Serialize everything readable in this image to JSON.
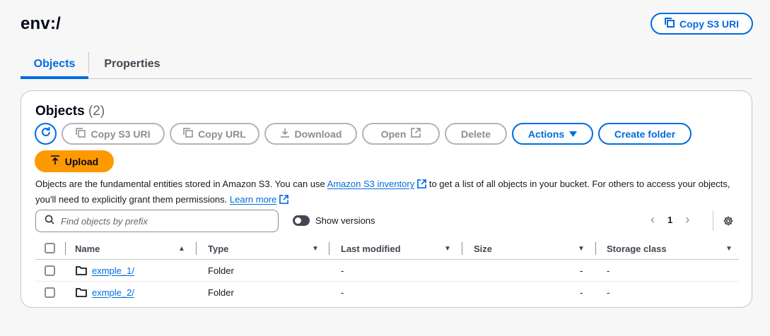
{
  "header": {
    "title": "env:/",
    "copy_s3_uri_label": "Copy S3 URI"
  },
  "tabs": [
    {
      "label": "Objects",
      "active": true
    },
    {
      "label": "Properties",
      "active": false
    }
  ],
  "panel": {
    "title": "Objects",
    "count": "(2)",
    "toolbar": {
      "copy_s3_uri": "Copy S3 URI",
      "copy_url": "Copy URL",
      "download": "Download",
      "open": "Open",
      "delete": "Delete",
      "actions": "Actions",
      "create_folder": "Create folder",
      "upload": "Upload"
    },
    "description": {
      "part1": "Objects are the fundamental entities stored in Amazon S3. You can use ",
      "inventory_link": "Amazon S3 inventory",
      "part2": " to get a list of all objects in your bucket. For others to access your objects, you'll need to explicitly grant them permissions. ",
      "learn_more": "Learn more"
    },
    "search": {
      "placeholder": "Find objects by prefix",
      "value": ""
    },
    "show_versions_label": "Show versions",
    "pagination": {
      "current_page": "1"
    },
    "columns": [
      "Name",
      "Type",
      "Last modified",
      "Size",
      "Storage class"
    ],
    "rows": [
      {
        "name": "exmple_1/",
        "type": "Folder",
        "last_modified": "-",
        "size": "-",
        "storage_class": "-"
      },
      {
        "name": "exmple_2/",
        "type": "Folder",
        "last_modified": "-",
        "size": "-",
        "storage_class": "-"
      }
    ]
  },
  "colors": {
    "accent": "#006ce0",
    "upload": "#ff9900",
    "disabled": "#8c8c94",
    "border": "#c6c6cd"
  },
  "icons": [
    "copy-icon",
    "refresh-icon",
    "download-icon",
    "external-link-icon",
    "caret-down-icon",
    "upload-arrow-icon",
    "search-icon",
    "chevron-left-icon",
    "chevron-right-icon",
    "gear-icon",
    "folder-icon",
    "sort-asc-icon",
    "sort-desc-icon"
  ]
}
